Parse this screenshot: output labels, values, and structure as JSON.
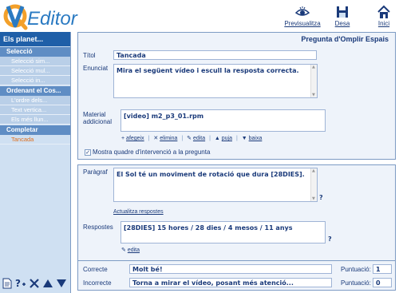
{
  "header": {
    "logo_text": "Editor",
    "logo_letter": "Q",
    "preview_label": "Previsualitza",
    "save_label": "Desa",
    "home_label": "Inici"
  },
  "sidebar": {
    "title": "Els planet...",
    "sections": [
      {
        "label": "Selecció",
        "items": [
          "Selecció sim...",
          "Selecció mul...",
          "Selecció in..."
        ]
      },
      {
        "label": "Ordenant el Cos...",
        "items": [
          "L'ordre dels...",
          "Text vertica...",
          "Els més llun..."
        ]
      },
      {
        "label": "Completar",
        "items": [
          "Tancada"
        ]
      }
    ],
    "active_item": "Tancada"
  },
  "panel_main": {
    "title": "Pregunta d'Omplir Espais",
    "title_label": "Títol",
    "title_value": "Tancada",
    "statement_label": "Enunciat",
    "statement_value": "Mira el següent vídeo i escull la resposta correcta.",
    "material_label_1": "Material",
    "material_label_2": "addicional",
    "material_value": "[video] m2_p3_01.rpm",
    "material_actions": {
      "add": "afegeix",
      "delete": "elimina",
      "edit": "edita",
      "up": "puja",
      "down": "baixa"
    },
    "show_box_label": "Mostra quadre d'intervenció a la pregunta",
    "show_box_checked": true
  },
  "panel_paragraph": {
    "paragraph_label": "Paràgraf",
    "paragraph_value": "El Sol té un moviment de rotació que dura [28DIES].",
    "help": "?",
    "update_link": "Actualitza respostes",
    "answers_label": "Respostes",
    "answers_value": "[28DIES] 15 hores / 28 dies / 4 mesos / 11 anys",
    "edit_link": "edita"
  },
  "panel_feedback": {
    "correct_label": "Correcte",
    "correct_value": "Molt bé!",
    "incorrect_label": "Incorrecte",
    "incorrect_value": "Torna a mirar el vídeo, posant més atenció...",
    "score_label": "Puntuació:",
    "correct_score": "1",
    "incorrect_score": "0"
  }
}
